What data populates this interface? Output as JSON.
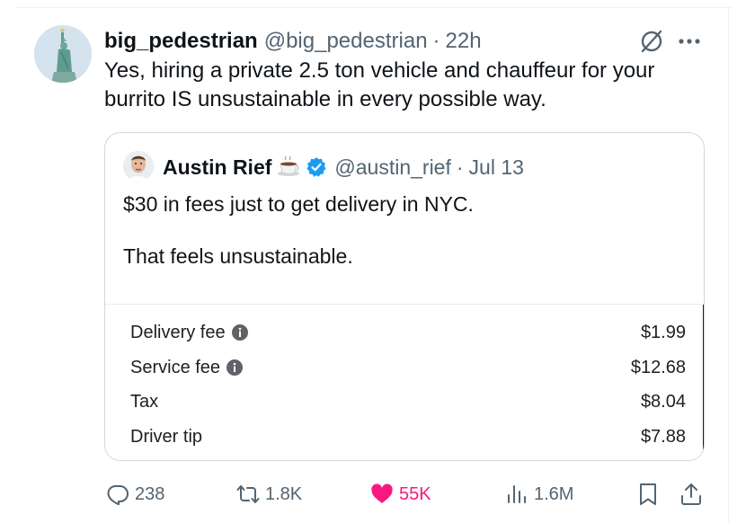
{
  "tweet": {
    "author_name": "big_pedestrian",
    "author_handle": "@big_pedestrian",
    "separator": "·",
    "time": "22h",
    "text": "Yes, hiring a private 2.5 ton vehicle and chauffeur for your burrito IS unsustainable in every possible way."
  },
  "quote": {
    "author_name": "Austin Rief",
    "author_handle": "@austin_rief",
    "separator": "·",
    "date": "Jul 13",
    "line1": "$30 in fees just to get delivery in NYC.",
    "line2": "That feels unsustainable.",
    "fees": [
      {
        "label": "Delivery fee",
        "amount": "$1.99",
        "info": true
      },
      {
        "label": "Service fee",
        "amount": "$12.68",
        "info": true
      },
      {
        "label": "Tax",
        "amount": "$8.04",
        "info": false
      },
      {
        "label": "Driver tip",
        "amount": "$7.88",
        "info": false
      }
    ]
  },
  "actions": {
    "replies": "238",
    "reposts": "1.8K",
    "likes": "55K",
    "views": "1.6M"
  },
  "colors": {
    "text": "#0f1419",
    "secondary": "#536471",
    "like": "#f91880",
    "verified": "#1d9bf0",
    "border": "#cfd9de"
  },
  "icons": [
    "grok-icon",
    "more-icon",
    "verified-icon",
    "coffee-emoji-icon",
    "info-icon",
    "reply-icon",
    "repost-icon",
    "heart-icon",
    "views-icon",
    "bookmark-icon",
    "share-icon"
  ]
}
